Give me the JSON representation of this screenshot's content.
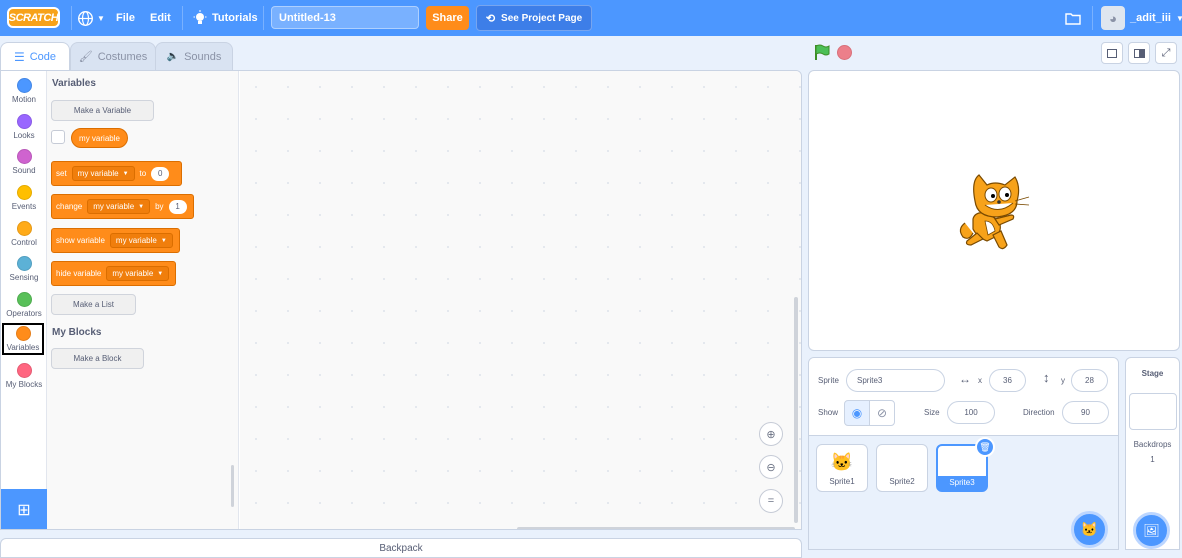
{
  "menubar": {
    "logo_text": "SCRATCH",
    "language_icon": "globe-icon",
    "file": "File",
    "edit": "Edit",
    "tutorials": "Tutorials",
    "project_title": "Untitled-13",
    "share": "Share",
    "see_project_page": "See Project Page",
    "username": "_adit_iii"
  },
  "tabs": {
    "code": "Code",
    "costumes": "Costumes",
    "sounds": "Sounds"
  },
  "categories": [
    {
      "label": "Motion",
      "color": "#4c97ff"
    },
    {
      "label": "Looks",
      "color": "#9966ff"
    },
    {
      "label": "Sound",
      "color": "#cf63cf"
    },
    {
      "label": "Events",
      "color": "#ffbf00"
    },
    {
      "label": "Control",
      "color": "#ffab19"
    },
    {
      "label": "Sensing",
      "color": "#5cb1d6"
    },
    {
      "label": "Operators",
      "color": "#59c059"
    },
    {
      "label": "Variables",
      "color": "#ff8c1a"
    },
    {
      "label": "My Blocks",
      "color": "#ff6680"
    }
  ],
  "palette": {
    "variables_heading": "Variables",
    "make_variable": "Make a Variable",
    "variable_reporter": "my variable",
    "set_block": {
      "label": "set",
      "var": "my variable",
      "to": "to",
      "value": "0"
    },
    "change_block": {
      "label": "change",
      "var": "my variable",
      "by": "by",
      "value": "1"
    },
    "show_block": {
      "label": "show variable",
      "var": "my variable"
    },
    "hide_block": {
      "label": "hide variable",
      "var": "my variable"
    },
    "make_list": "Make a List",
    "myblocks_heading": "My Blocks",
    "make_block": "Make a Block"
  },
  "backpack": "Backpack",
  "sprite_info": {
    "sprite_label": "Sprite",
    "sprite_name": "Sprite3",
    "x_label": "x",
    "x_value": "36",
    "y_label": "y",
    "y_value": "28",
    "show_label": "Show",
    "size_label": "Size",
    "size_value": "100",
    "direction_label": "Direction",
    "direction_value": "90"
  },
  "sprites": [
    {
      "name": "Sprite1",
      "selected": false
    },
    {
      "name": "Sprite2",
      "selected": false
    },
    {
      "name": "Sprite3",
      "selected": true
    }
  ],
  "stage_panel": {
    "title": "Stage",
    "backdrops_label": "Backdrops",
    "backdrops_count": "1"
  },
  "colors": {
    "brand_blue": "#4c97ff",
    "variables_orange": "#ff8c1a",
    "share_orange": "#ff8c1a"
  }
}
